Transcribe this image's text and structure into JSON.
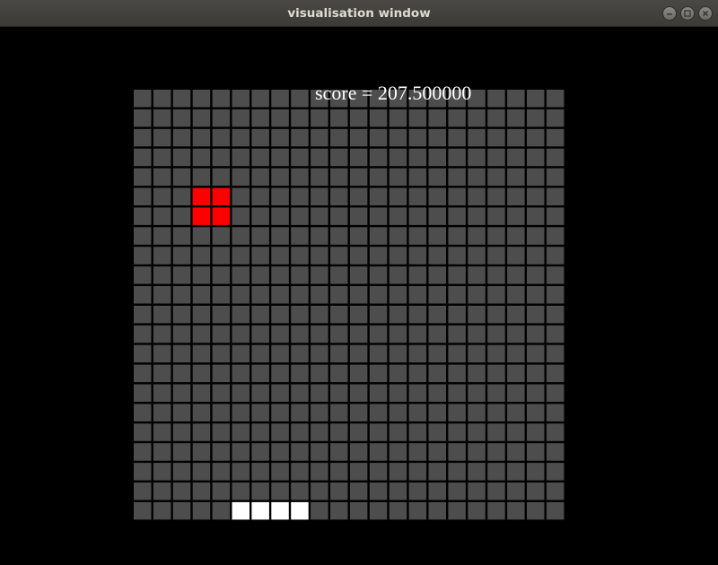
{
  "window": {
    "title": "visualisation window",
    "buttons": [
      "minimize",
      "maximize",
      "close"
    ]
  },
  "game": {
    "score_text": "score = 207.500000",
    "grid": {
      "columns": 22,
      "rows": 22
    },
    "colors": {
      "background": "#000000",
      "empty_cell": "#4d4d4d",
      "food": "#ff0000",
      "snake": "#ffffff"
    },
    "food_cells": [
      [
        3,
        5
      ],
      [
        4,
        5
      ],
      [
        3,
        6
      ],
      [
        4,
        6
      ]
    ],
    "snake_cells": [
      [
        5,
        21
      ],
      [
        6,
        21
      ],
      [
        7,
        21
      ],
      [
        8,
        21
      ]
    ]
  }
}
